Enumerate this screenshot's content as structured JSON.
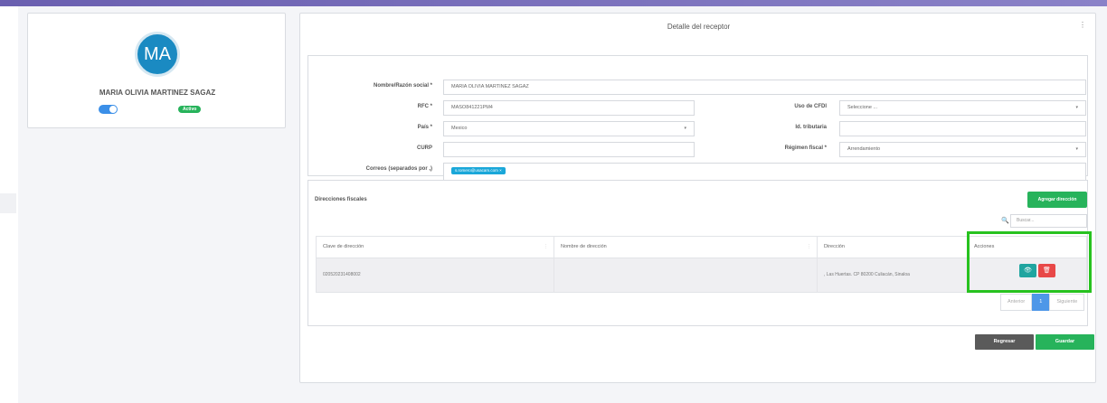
{
  "profile": {
    "initials": "MA",
    "name": "MARIA OLIVIA MARTINEZ SAGAZ",
    "status": "Activo"
  },
  "detail": {
    "title": "Detalle del receptor",
    "menu_icon": "⋮"
  },
  "form": {
    "nombre_label": "Nombre/Razón social *",
    "nombre_value": "MARIA OLIVIA MARTINEZ SAGAZ",
    "rfc_label": "RFC *",
    "rfc_value": "MASO841221PM4",
    "uso_cfdi_label": "Uso de CFDI",
    "uso_cfdi_value": "Seleccione ...",
    "pais_label": "País *",
    "pais_value": "Mexico",
    "id_tributaria_label": "Id. tributaria",
    "id_tributaria_value": "",
    "curp_label": "CURP",
    "curp_value": "",
    "regimen_label": "Régimen fiscal *",
    "regimen_value": "Arrendamiento",
    "correos_label": "Correos (separados por ,)",
    "correo_chip": "s.romero@usacam.com ×"
  },
  "direcciones": {
    "title": "Direcciones fiscales",
    "add_button": "Agregar dirección",
    "search_placeholder": "Buscar...",
    "columns": [
      "Clave de dirección",
      "Nombre de dirección",
      "Dirección",
      "Acciones"
    ],
    "rows": [
      {
        "clave": "020520231408002",
        "nombre": "",
        "direccion": ", Las Huertas. CP 80200 Culiacán, Sinaloa"
      }
    ],
    "pager": {
      "prev": "Anterior",
      "page": "1",
      "next": "Siguiente"
    }
  },
  "actions": {
    "back": "Regresar",
    "save": "Guardar"
  },
  "colors": {
    "primary_green": "#27b35b",
    "avatar_blue": "#1a8ac2",
    "teal": "#20a5a0",
    "danger": "#e84848",
    "highlight": "#27c21f"
  }
}
